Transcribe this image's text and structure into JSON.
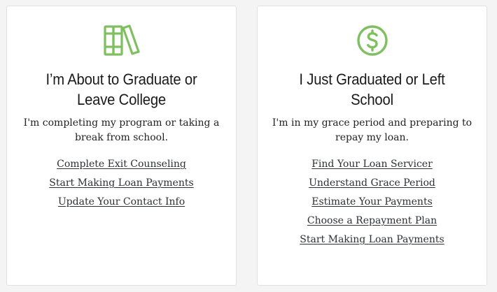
{
  "accent_color": "#7cc15c",
  "cards": [
    {
      "icon": "books-icon",
      "title_line1": "I’m About to Graduate or",
      "title_line2": "Leave College",
      "desc_line1": "I'm completing my program or taking a",
      "desc_line2": "break from school.",
      "links": [
        "Complete Exit Counseling",
        "Start Making Loan Payments",
        "Update Your Contact Info"
      ]
    },
    {
      "icon": "dollar-coin-icon",
      "title_line1": "I Just Graduated or Left",
      "title_line2": "School",
      "desc_line1": "I'm in my grace period and preparing to",
      "desc_line2": "repay my loan.",
      "links": [
        "Find Your Loan Servicer",
        "Understand Grace Period",
        "Estimate Your Payments",
        "Choose a Repayment Plan",
        "Start Making Loan Payments"
      ]
    }
  ]
}
